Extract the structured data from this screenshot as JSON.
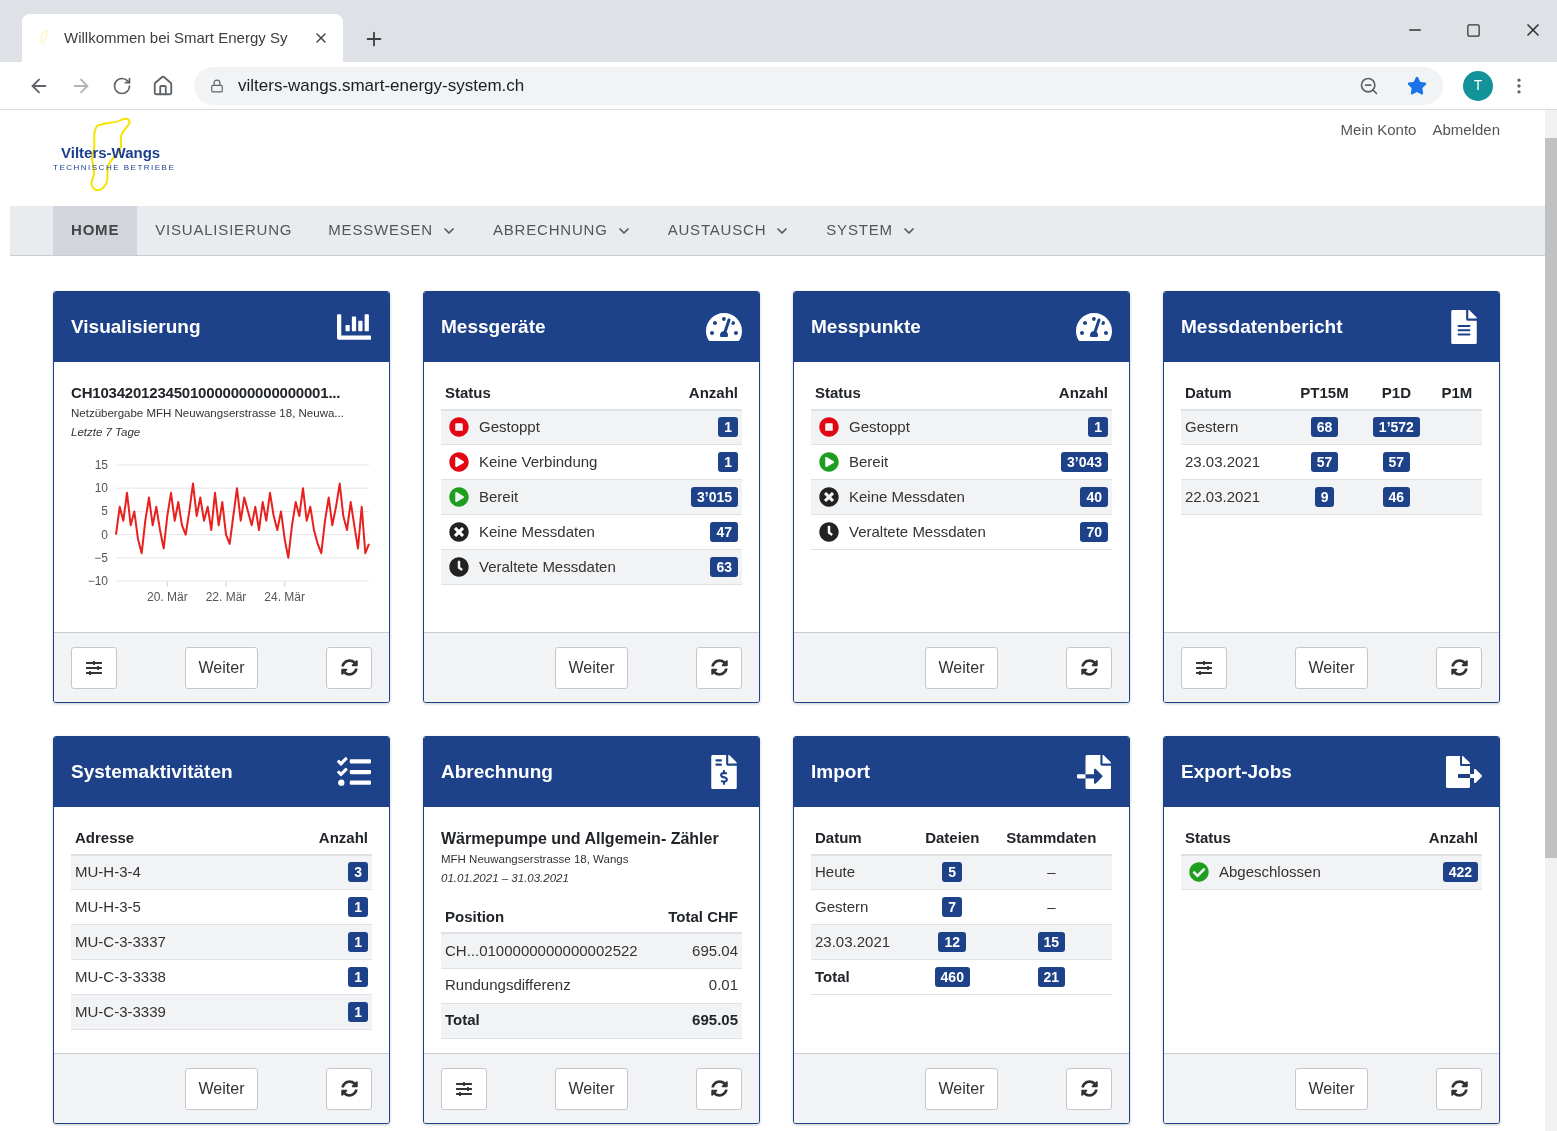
{
  "browser": {
    "tab_title": "Willkommen bei Smart Energy Sy",
    "url": "vilters-wangs.smart-energy-system.ch",
    "avatar": "T"
  },
  "header": {
    "logo": {
      "name": "Vilters-Wangs",
      "subtitle": "TECHNISCHE BETRIEBE"
    },
    "links": [
      "Mein Konto",
      "Abmelden"
    ]
  },
  "nav": [
    {
      "label": "HOME",
      "selected": true,
      "dropdown": false
    },
    {
      "label": "VISUALISIERUNG",
      "selected": false,
      "dropdown": false
    },
    {
      "label": "MESSWESEN",
      "selected": false,
      "dropdown": true
    },
    {
      "label": "ABRECHNUNG",
      "selected": false,
      "dropdown": true
    },
    {
      "label": "AUSTAUSCH",
      "selected": false,
      "dropdown": true
    },
    {
      "label": "SYSTEM",
      "selected": false,
      "dropdown": true
    }
  ],
  "cards": [
    {
      "title": "Visualisierung",
      "kind": "chart",
      "heading": "CH10342012345010000000000000001...",
      "subheading": "Netzübergabe MFH Neuwangserstrasse 18, Neuwa...",
      "period": "Letzte 7 Tage",
      "chart_data": {
        "type": "line",
        "grid": true,
        "x": [
          18.25,
          18.375,
          18.5,
          18.625,
          18.75,
          18.875,
          19,
          19.125,
          19.25,
          19.375,
          19.5,
          19.625,
          19.75,
          19.875,
          20,
          20.125,
          20.25,
          20.375,
          20.5,
          20.625,
          20.75,
          20.875,
          21,
          21.125,
          21.25,
          21.375,
          21.5,
          21.625,
          21.75,
          21.875,
          22,
          22.125,
          22.25,
          22.375,
          22.5,
          22.625,
          22.75,
          22.875,
          23,
          23.125,
          23.25,
          23.375,
          23.5,
          23.625,
          23.75,
          23.875,
          24,
          24.125,
          24.25,
          24.375,
          24.5,
          24.625,
          24.75,
          24.875,
          25,
          25.125,
          25.25,
          25.375,
          25.5,
          25.625,
          25.75,
          25.875,
          26,
          26.125,
          26.25,
          26.375,
          26.5,
          26.625,
          26.75,
          26.875
        ],
        "xlim": [
          18.25,
          26.875
        ],
        "ylim": [
          -10,
          15
        ],
        "xticks": [
          {
            "value": 20,
            "label": "20. Mär"
          },
          {
            "value": 22,
            "label": "22. Mär"
          },
          {
            "value": 24,
            "label": "24. Mär"
          }
        ],
        "yticks": [
          {
            "value": -10,
            "label": "−10"
          },
          {
            "value": -5,
            "label": "−5"
          },
          0,
          5,
          10,
          15
        ],
        "series": [
          {
            "color": "#e8201e",
            "values": [
              0,
              6,
              3,
              9,
              2,
              5,
              -1,
              -4,
              3,
              8,
              2,
              6,
              1,
              -3,
              4,
              9,
              3,
              7,
              2,
              0,
              5,
              11,
              4,
              8,
              3,
              6,
              1,
              9,
              2,
              7,
              0,
              -2,
              4,
              10,
              3,
              8,
              5,
              2,
              6,
              1,
              7,
              3,
              9,
              4,
              1,
              5,
              -1,
              -5,
              2,
              7,
              4,
              10,
              3,
              6,
              1,
              -2,
              -4,
              3,
              8,
              2,
              6,
              11,
              4,
              1,
              7,
              2,
              -3,
              6,
              -4,
              -2
            ]
          }
        ]
      },
      "footer": {
        "filter": true,
        "next": "Weiter"
      }
    },
    {
      "title": "Messgeräte",
      "kind": "table",
      "table": {
        "columns": [
          "Status",
          "Anzahl"
        ],
        "rows": [
          {
            "kind": "stopped",
            "cells": [
              "Gestoppt",
              {
                "badge": "1"
              }
            ]
          },
          {
            "kind": "no_connection",
            "cells": [
              "Keine Verbindung",
              {
                "badge": "1"
              }
            ]
          },
          {
            "kind": "ready",
            "cells": [
              "Bereit",
              {
                "badge": "3’015"
              }
            ]
          },
          {
            "kind": "no_data",
            "cells": [
              "Keine Messdaten",
              {
                "badge": "47"
              }
            ]
          },
          {
            "kind": "outdated",
            "cells": [
              "Veraltete Messdaten",
              {
                "badge": "63"
              }
            ]
          }
        ]
      },
      "footer": {
        "filter": false,
        "next": "Weiter"
      }
    },
    {
      "title": "Messpunkte",
      "kind": "table",
      "table": {
        "columns": [
          "Status",
          "Anzahl"
        ],
        "rows": [
          {
            "kind": "stopped",
            "cells": [
              "Gestoppt",
              {
                "badge": "1"
              }
            ]
          },
          {
            "kind": "ready",
            "cells": [
              "Bereit",
              {
                "badge": "3’043"
              }
            ]
          },
          {
            "kind": "no_data",
            "cells": [
              "Keine Messdaten",
              {
                "badge": "40"
              }
            ]
          },
          {
            "kind": "outdated",
            "cells": [
              "Veraltete Messdaten",
              {
                "badge": "70"
              }
            ]
          }
        ]
      },
      "footer": {
        "filter": false,
        "next": "Weiter"
      }
    },
    {
      "title": "Messdatenbericht",
      "kind": "table",
      "table": {
        "columns": [
          "Datum",
          "PT15M",
          "P1D",
          "P1M"
        ],
        "rows": [
          {
            "kind": "item",
            "cells": [
              "Gestern",
              {
                "badge": "68"
              },
              {
                "badge": "1’572"
              },
              null
            ]
          },
          {
            "kind": "item",
            "cells": [
              "23.03.2021",
              {
                "badge": "57"
              },
              {
                "badge": "57"
              },
              null
            ]
          },
          {
            "kind": "item",
            "cells": [
              "22.03.2021",
              {
                "badge": "9"
              },
              {
                "badge": "46"
              },
              null
            ]
          }
        ]
      },
      "footer": {
        "filter": true,
        "next": "Weiter"
      }
    },
    {
      "title": "Systemaktivitäten",
      "kind": "table",
      "table": {
        "columns": [
          "Adresse",
          "Anzahl"
        ],
        "rows": [
          {
            "kind": "item",
            "cells": [
              "MU-H-3-4",
              {
                "badge": "3"
              }
            ]
          },
          {
            "kind": "item",
            "cells": [
              "MU-H-3-5",
              {
                "badge": "1"
              }
            ]
          },
          {
            "kind": "item",
            "cells": [
              "MU-C-3-3337",
              {
                "badge": "1"
              }
            ]
          },
          {
            "kind": "item",
            "cells": [
              "MU-C-3-3338",
              {
                "badge": "1"
              }
            ]
          },
          {
            "kind": "item",
            "cells": [
              "MU-C-3-3339",
              {
                "badge": "1"
              }
            ]
          }
        ]
      },
      "footer": {
        "filter": false,
        "next": "Weiter"
      }
    },
    {
      "title": "Abrechnung",
      "kind": "billing",
      "heading": "Wärmepumpe und Allgemein- Zähler",
      "subheading": "MFH Neuwangserstrasse 18, Wangs",
      "period": "01.01.2021 – 31.03.2021",
      "table": {
        "columns": [
          "Position",
          "Total CHF"
        ],
        "rows": [
          {
            "kind": "item",
            "cells": [
              "CH...0100000000000002522",
              "695.04"
            ]
          },
          {
            "kind": "item",
            "cells": [
              "Rundungsdifferenz",
              "0.01"
            ]
          },
          {
            "kind": "total",
            "cells": [
              "Total",
              "695.05"
            ]
          }
        ]
      },
      "footer": {
        "filter": true,
        "next": "Weiter"
      }
    },
    {
      "title": "Import",
      "kind": "table",
      "table": {
        "columns": [
          "Datum",
          "Dateien",
          "Stammdaten"
        ],
        "rows": [
          {
            "kind": "item",
            "cells": [
              "Heute",
              {
                "badge": "5"
              },
              "–"
            ]
          },
          {
            "kind": "item",
            "cells": [
              "Gestern",
              {
                "badge": "7"
              },
              "–"
            ]
          },
          {
            "kind": "item",
            "cells": [
              "23.03.2021",
              {
                "badge": "12"
              },
              {
                "badge": "15"
              }
            ]
          },
          {
            "kind": "total",
            "cells": [
              "Total",
              {
                "badge": "460"
              },
              {
                "badge": "21"
              }
            ]
          }
        ]
      },
      "footer": {
        "filter": false,
        "next": "Weiter"
      }
    },
    {
      "title": "Export-Jobs",
      "kind": "table",
      "table": {
        "columns": [
          "Status",
          "Anzahl"
        ],
        "rows": [
          {
            "kind": "done",
            "cells": [
              "Abgeschlossen",
              {
                "badge": "422"
              }
            ]
          }
        ]
      },
      "footer": {
        "filter": false,
        "next": "Weiter"
      }
    }
  ]
}
